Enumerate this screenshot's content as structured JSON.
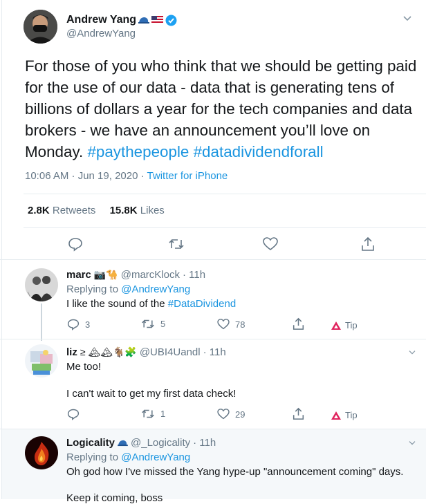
{
  "main_tweet": {
    "name": "Andrew Yang",
    "handle": "@AndrewYang",
    "text_plain": "For those of you who think that we should be getting paid for the use of our data - data that is generating tens of billions of dollars a year for the tech companies and data brokers - we have an announcement you’ll love on Monday.",
    "hashtag1": "#paythepeople",
    "hashtag2": "#datadividendforall",
    "time": "10:06 AM · Jun 19, 2020",
    "sep": "·",
    "source": "Twitter for iPhone",
    "retweets_count": "2.8K",
    "retweets_label": "Retweets",
    "likes_count": "15.8K",
    "likes_label": "Likes"
  },
  "replies": [
    {
      "name": "marc",
      "emoji": "📷🐪",
      "handle": "@marcKlock",
      "time": "· 11h",
      "replying_label": "Replying to",
      "replying_to": "@AndrewYang",
      "text_plain": "I like the sound of the",
      "hashtag": "#DataDividend",
      "reply_count": "3",
      "retweet_count": "5",
      "like_count": "78",
      "tip_label": "Tip"
    },
    {
      "name": "liz",
      "emoji": "≥ 🏔🏔🐐🧩",
      "handle": "@UBI4Uandl",
      "time": "· 11h",
      "line1": "Me too!",
      "line2": "I can't wait to get my first data check!",
      "reply_count": "",
      "retweet_count": "1",
      "like_count": "29",
      "tip_label": "Tip"
    },
    {
      "name": "Logicality",
      "handle": "@_Logicality",
      "time": "· 11h",
      "replying_label": "Replying to",
      "replying_to": "@AndrewYang",
      "line1": "Oh god how I've missed the Yang hype-up \"announcement coming\" days.",
      "line2": "Keep it coming, boss"
    }
  ],
  "colors": {
    "link": "#1b95e0",
    "muted": "#657786",
    "tip_red": "#e0245e",
    "verified": "#1da1f2"
  }
}
